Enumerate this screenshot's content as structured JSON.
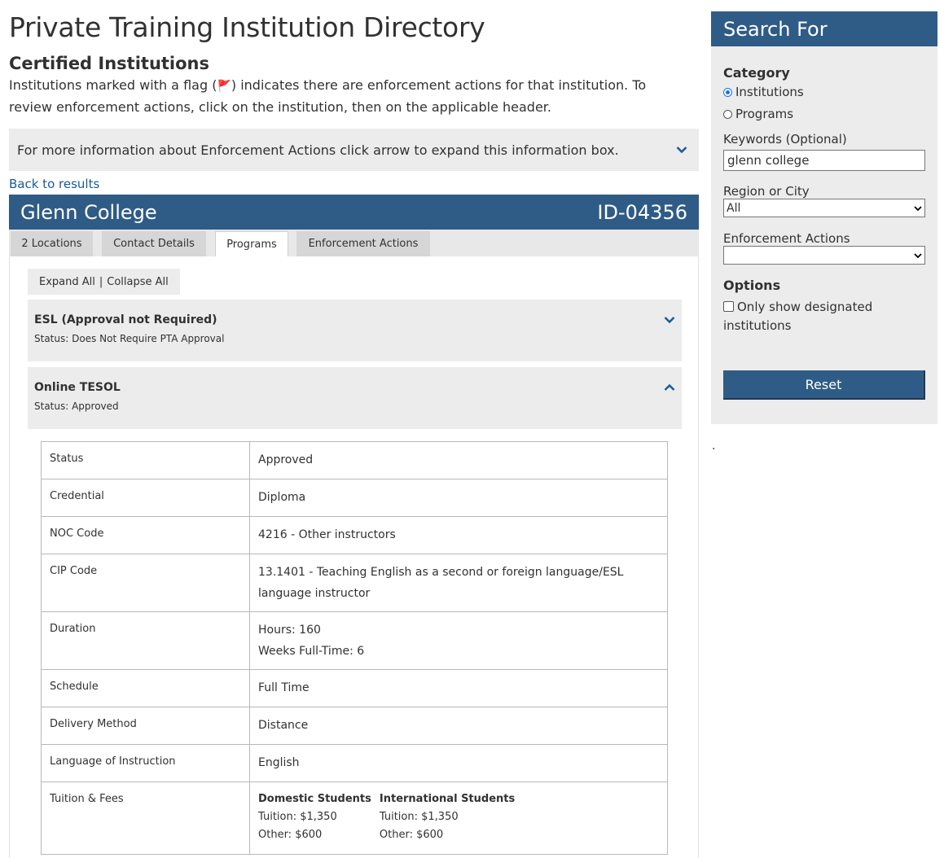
{
  "page": {
    "title": "Private Training Institution Directory",
    "section_title": "Certified Institutions",
    "intro_before_flag": "Institutions marked with a flag (",
    "intro_flag": "🚩",
    "intro_after_flag": ") indicates there are enforcement actions for that institution. To review enforcement actions, click on the institution, then on the applicable header.",
    "info_box": "For more information about Enforcement Actions click arrow to expand this information box.",
    "back_link": "Back to results"
  },
  "institution": {
    "name": "Glenn College",
    "id": "ID-04356",
    "tabs": [
      "2 Locations",
      "Contact Details",
      "Programs",
      "Enforcement Actions"
    ],
    "active_tab": "Programs",
    "expand_all": "Expand All",
    "separator": "|",
    "collapse_all": "Collapse All"
  },
  "programs": [
    {
      "title": "ESL (Approval not Required)",
      "status": "Status: Does Not Require PTA Approval",
      "expanded": false
    },
    {
      "title": "Online TESOL",
      "status": "Status: Approved",
      "expanded": true
    }
  ],
  "details": {
    "rows": [
      {
        "label": "Status",
        "value": "Approved"
      },
      {
        "label": "Credential",
        "value": "Diploma"
      },
      {
        "label": "NOC Code",
        "value": "4216 - Other instructors"
      },
      {
        "label": "CIP Code",
        "value": "13.1401 - Teaching English as a second or foreign language/ESL language instructor"
      },
      {
        "label": "Duration",
        "value_line1": "Hours: 160",
        "value_line2": "Weeks Full-Time: 6"
      },
      {
        "label": "Schedule",
        "value": "Full Time"
      },
      {
        "label": "Delivery Method",
        "value": "Distance"
      },
      {
        "label": "Language of Instruction",
        "value": "English"
      },
      {
        "label": "Tuition & Fees"
      }
    ],
    "fees": {
      "domestic": {
        "heading": "Domestic Students",
        "tuition": "Tuition: $1,350",
        "other": "Other: $600"
      },
      "international": {
        "heading": "International Students",
        "tuition": "Tuition: $1,350",
        "other": "Other: $600"
      }
    }
  },
  "sidebar": {
    "title": "Search For",
    "category_label": "Category",
    "category_options": [
      "Institutions",
      "Programs"
    ],
    "category_selected": "Institutions",
    "keywords_label": "Keywords (Optional)",
    "keywords_value": "glenn college",
    "region_label": "Region or City",
    "region_value": "All",
    "enforcement_label": "Enforcement Actions",
    "enforcement_value": "",
    "options_label": "Options",
    "designated_label": "Only show designated institutions",
    "reset_label": "Reset"
  },
  "stray_mark": ".",
  "colors": {
    "brand_blue": "#2f5c86",
    "link": "#1a5a96",
    "panel_grey": "#ececec",
    "flag_red": "#d8292f"
  },
  "icons": {
    "expand": "chevron-down-icon",
    "collapse": "chevron-up-icon",
    "select": "dropdown-arrow-icon"
  }
}
